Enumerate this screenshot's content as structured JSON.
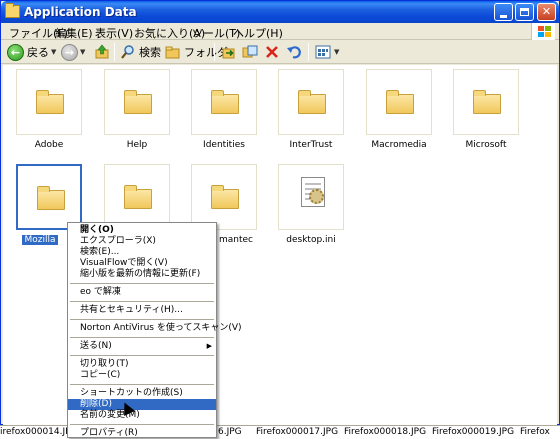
{
  "window": {
    "title": "Application Data"
  },
  "menubar": [
    "ファイル(F)",
    "編集(E)",
    "表示(V)",
    "お気に入り(A)",
    "ツール(T)",
    "ヘルプ(H)"
  ],
  "toolbar": {
    "back": "戻る",
    "search": "検索",
    "folders": "フォルダ"
  },
  "items": [
    {
      "label": "Adobe",
      "type": "folder"
    },
    {
      "label": "Help",
      "type": "folder"
    },
    {
      "label": "Identities",
      "type": "folder"
    },
    {
      "label": "InterTrust",
      "type": "folder"
    },
    {
      "label": "Macromedia",
      "type": "folder"
    },
    {
      "label": "Microsoft",
      "type": "folder"
    },
    {
      "label": "Mozilla",
      "type": "folder",
      "selected": true
    },
    {
      "label": "",
      "type": "folder"
    },
    {
      "label": "mantec",
      "type": "folder"
    },
    {
      "label": "desktop.ini",
      "type": "file"
    }
  ],
  "bottom_files": [
    "irefox000014.JPG",
    "6.JPG",
    "Firefox000017.JPG",
    "Firefox000018.JPG",
    "Firefox000019.JPG",
    "Firefox"
  ],
  "context_menu": {
    "open": "開く(O)",
    "explorer": "エクスプローラ(X)",
    "search": "検索(E)...",
    "visualflow": "VisualFlowで開く(V)",
    "shrink": "縮小版を最新の情報に更新(F)",
    "eo": "eo で解凍",
    "share": "共有とセキュリティ(H)...",
    "norton": "Norton AntiVirus を使ってスキャン(V)",
    "sendto": "送る(N)",
    "cut": "切り取り(T)",
    "copy": "コピー(C)",
    "shortcut": "ショートカットの作成(S)",
    "delete": "削除(D)",
    "rename": "名前の変更(M)",
    "properties": "プロパティ(R)"
  }
}
